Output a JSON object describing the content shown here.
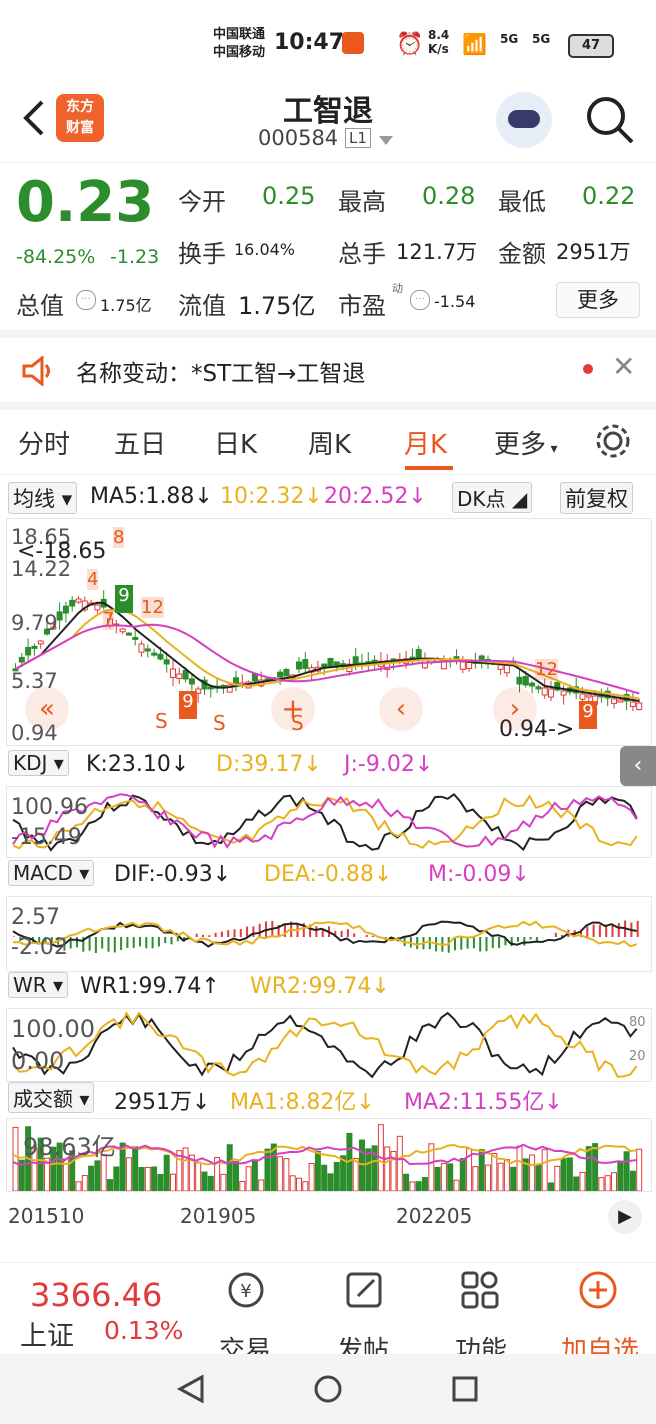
{
  "status_bar": {
    "carrier1": "中国联通",
    "carrier2": "中国移动",
    "time": "10:47",
    "speed_top": "8.4",
    "speed_bottom": "K/s",
    "sig1": "5G",
    "sig2": "5G",
    "battery": "47"
  },
  "header": {
    "logo_line1": "东方",
    "logo_line2": "财富",
    "title": "工智退",
    "code": "000584",
    "level": "L1"
  },
  "quote": {
    "price": "0.23",
    "change_pct": "-84.25%",
    "change": "-1.23",
    "open_label": "今开",
    "open": "0.25",
    "high_label": "最高",
    "high": "0.28",
    "low_label": "最低",
    "low": "0.22",
    "turnover_label": "换手",
    "turnover": "16.04%",
    "volume_label": "总手",
    "volume": "121.7万",
    "amount_label": "金额",
    "amount": "2951万",
    "mktcap_label": "总值",
    "mktcap": "1.75亿",
    "float_label": "流值",
    "float": "1.75亿",
    "pe_label": "市盈",
    "pe_sup": "动",
    "pe": "-1.54",
    "more_label": "更多"
  },
  "notice": {
    "text": "名称变动：*ST工智→工智退"
  },
  "tabs": {
    "t1": "分时",
    "t2": "五日",
    "t3": "日K",
    "t4": "周K",
    "t5": "月K",
    "t6": "更多",
    "active": "月K"
  },
  "ma_row": {
    "dd": "均线",
    "ma5": "MA5:1.88↓",
    "ma10": "10:2.32↓",
    "ma20": "20:2.52↓",
    "dk": "DK点",
    "fq": "前复权"
  },
  "kline": {
    "ymax": "18.65",
    "ymax_label": "<-18.65",
    "y2": "14.22",
    "y3": "9.79",
    "y4": "5.37",
    "ymin": "0.94",
    "ymin_label": "0.94->",
    "marks": {
      "s": "S",
      "plus": "+",
      "nine": "9",
      "seven": "7",
      "eight": "8",
      "four": "4",
      "twelve": "12"
    }
  },
  "kdj_row": {
    "dd": "KDJ",
    "k": "K:23.10↓",
    "d": "D:39.17↓",
    "j": "J:-9.02↓",
    "ytop": "100.96",
    "ybot": "-15.49"
  },
  "macd_row": {
    "dd": "MACD",
    "dif": "DIF:-0.93↓",
    "dea": "DEA:-0.88↓",
    "m": "M:-0.09↓",
    "ytop": "2.57",
    "ybot": "-2.02"
  },
  "wr_row": {
    "dd": "WR",
    "wr1": "WR1:99.74↑",
    "wr2": "WR2:99.74↓",
    "ytop": "100.00",
    "ybot": "0.00",
    "r80": "80",
    "r20": "20"
  },
  "vol_row": {
    "dd": "成交额",
    "v": "2951万↓",
    "ma1": "MA1:8.82亿↓",
    "ma2": "MA2:11.55亿↓",
    "ytop": "98.63亿"
  },
  "xaxis": {
    "d1": "201510",
    "d2": "201905",
    "d3": "202205"
  },
  "bottom": {
    "index_val": "3366.46",
    "index_name": "上证",
    "index_pct": "0.13%",
    "trade": "交易",
    "post": "发帖",
    "func": "功能",
    "fav": "加自选"
  },
  "colors": {
    "up": "#e03a3a",
    "down": "#2b8d2b",
    "accent": "#e8581f",
    "ma5": "#222222",
    "ma10": "#e8b21e",
    "ma20": "#d63fc0"
  }
}
